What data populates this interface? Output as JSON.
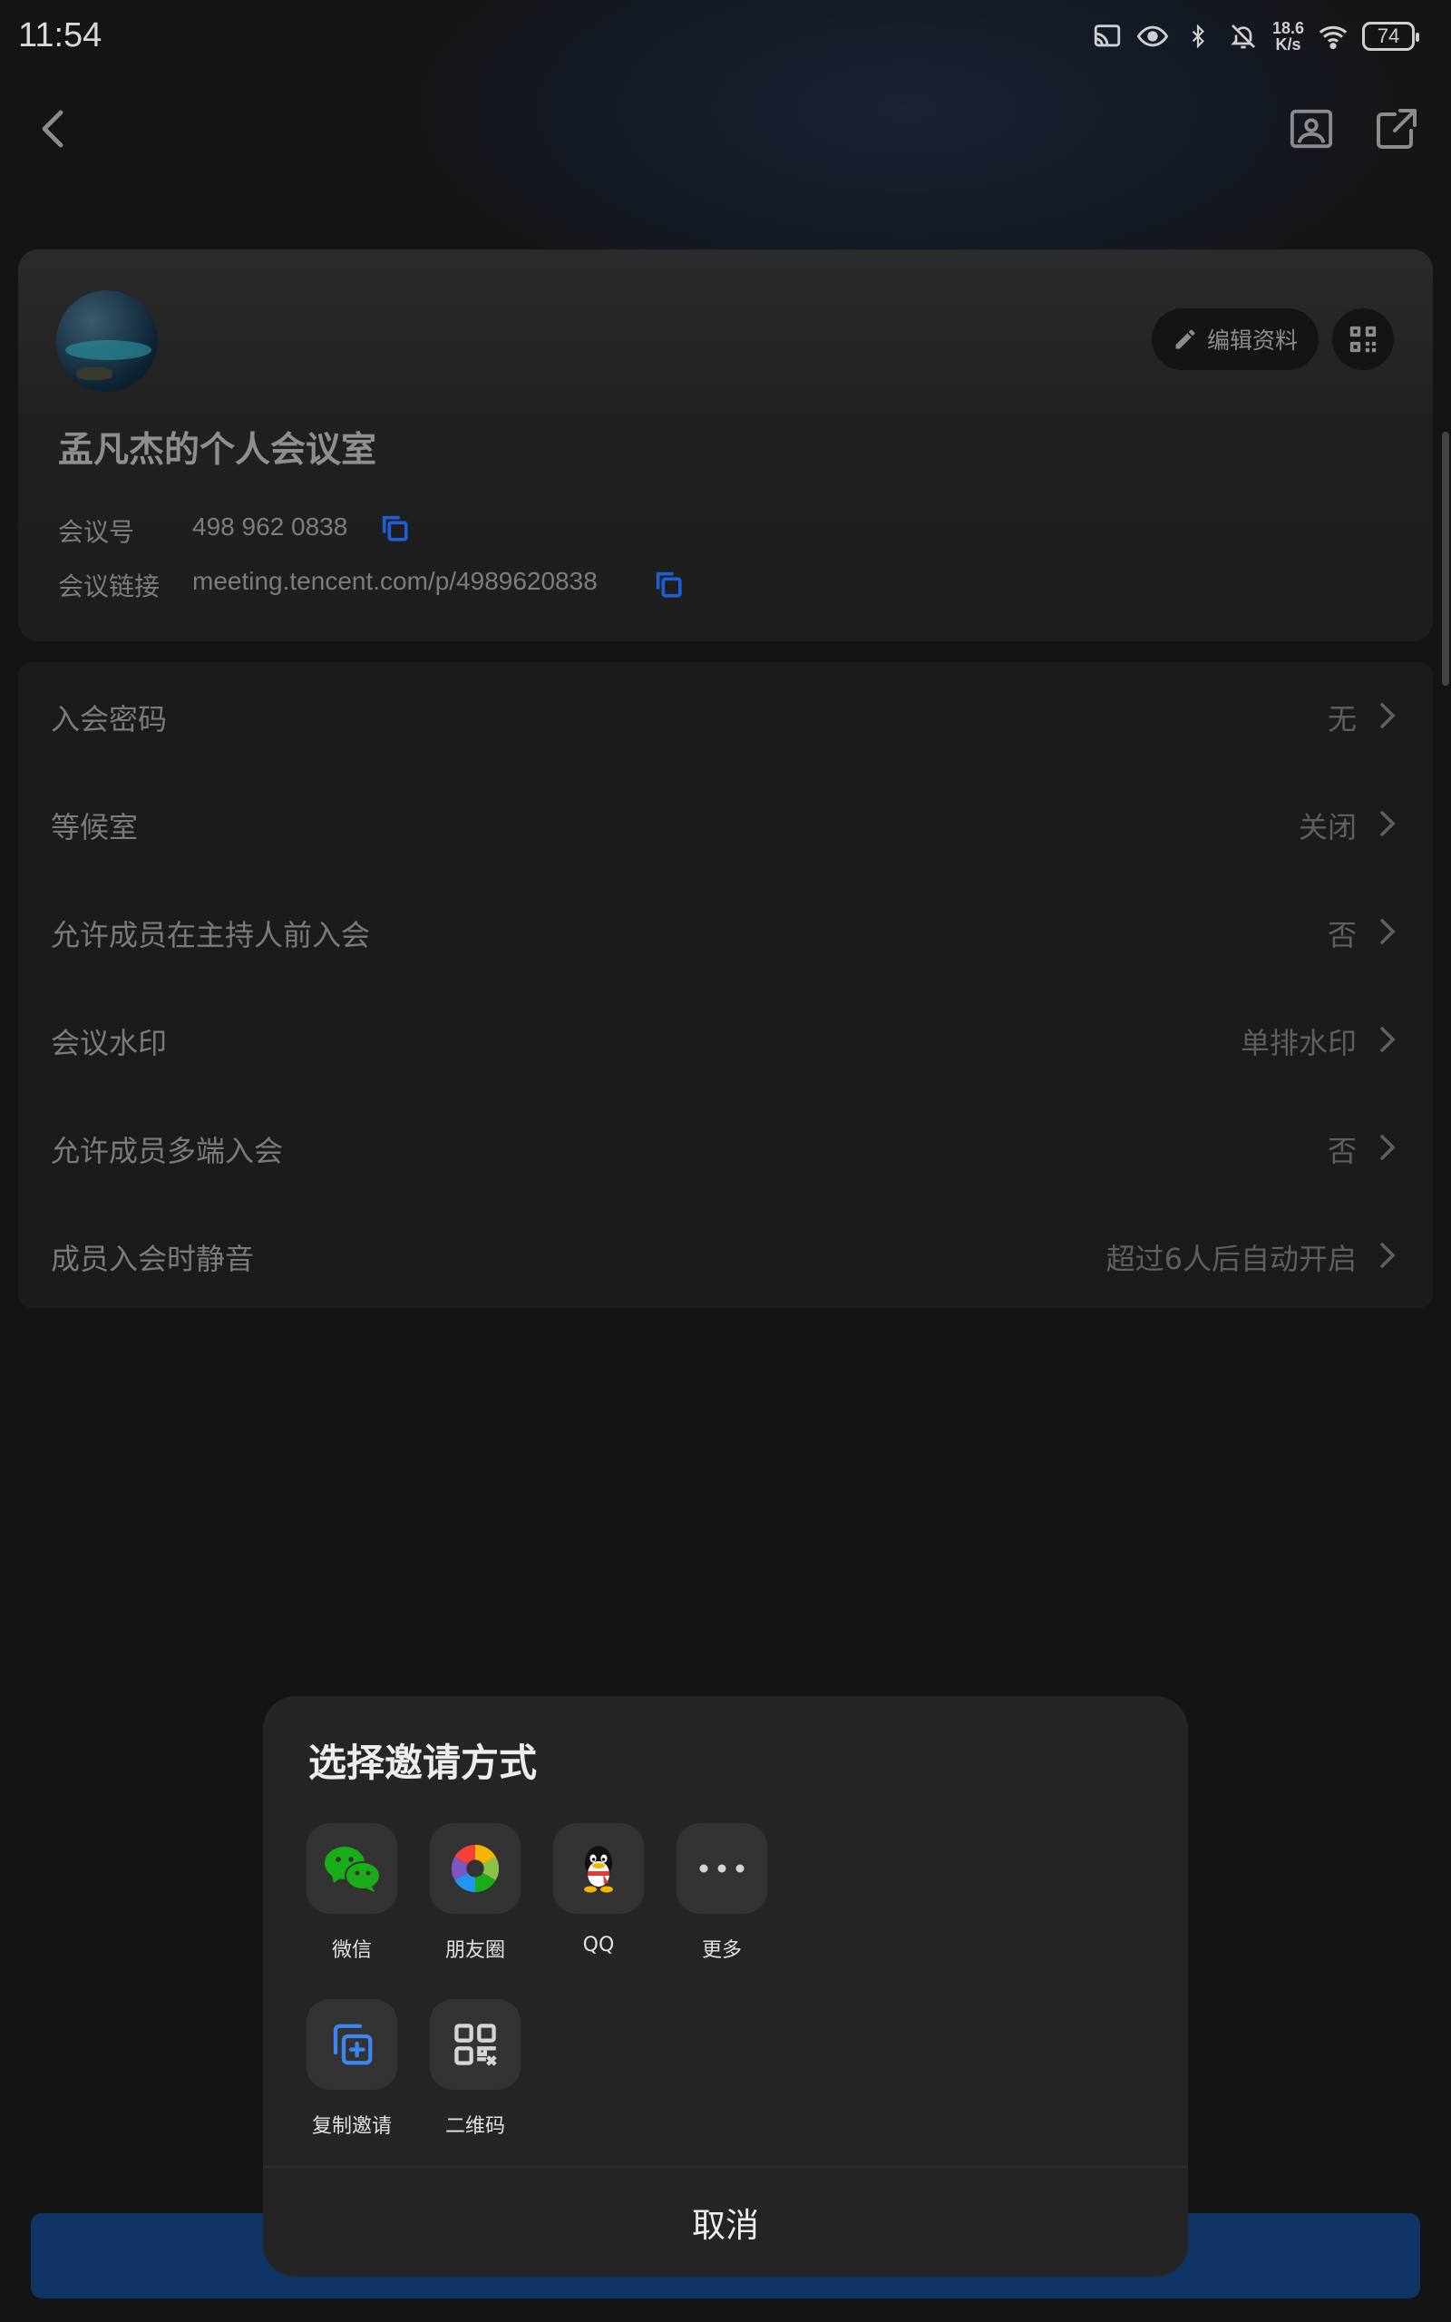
{
  "status_bar": {
    "time": "11:54",
    "net_speed_top": "18.6",
    "net_speed_bottom": "K/s",
    "battery": "74",
    "icons": [
      "cast-icon",
      "eye-icon",
      "bluetooth-icon",
      "bell-muted-icon",
      "wifi-icon",
      "battery-icon"
    ]
  },
  "nav": {
    "back_icon": "chevron-left-icon",
    "image_icon": "image-icon",
    "share_icon": "share-icon"
  },
  "profile": {
    "edit_label": "编辑资料",
    "room_title": "孟凡杰的个人会议室",
    "meeting_id_label": "会议号",
    "meeting_id_value": "498 962 0838",
    "meeting_link_label": "会议链接",
    "meeting_link_value": "meeting.tencent.com/p/4989620838",
    "accent_color": "#1f5fd6"
  },
  "settings": [
    {
      "label": "入会密码",
      "value": "无"
    },
    {
      "label": "等候室",
      "value": "关闭"
    },
    {
      "label": "允许成员在主持人前入会",
      "value": "否"
    },
    {
      "label": "会议水印",
      "value": "单排水印"
    },
    {
      "label": "允许成员多端入会",
      "value": "否"
    },
    {
      "label": "成员入会时静音",
      "value": "超过6人后自动开启"
    }
  ],
  "share_sheet": {
    "title": "选择邀请方式",
    "items": [
      {
        "label": "微信",
        "icon": "wechat-icon"
      },
      {
        "label": "朋友圈",
        "icon": "moments-icon"
      },
      {
        "label": "QQ",
        "icon": "qq-icon"
      },
      {
        "label": "更多",
        "icon": "more-icon"
      },
      {
        "label": "复制邀请",
        "icon": "copy-invite-icon"
      },
      {
        "label": "二维码",
        "icon": "qrcode-icon"
      }
    ],
    "cancel": "取消"
  }
}
